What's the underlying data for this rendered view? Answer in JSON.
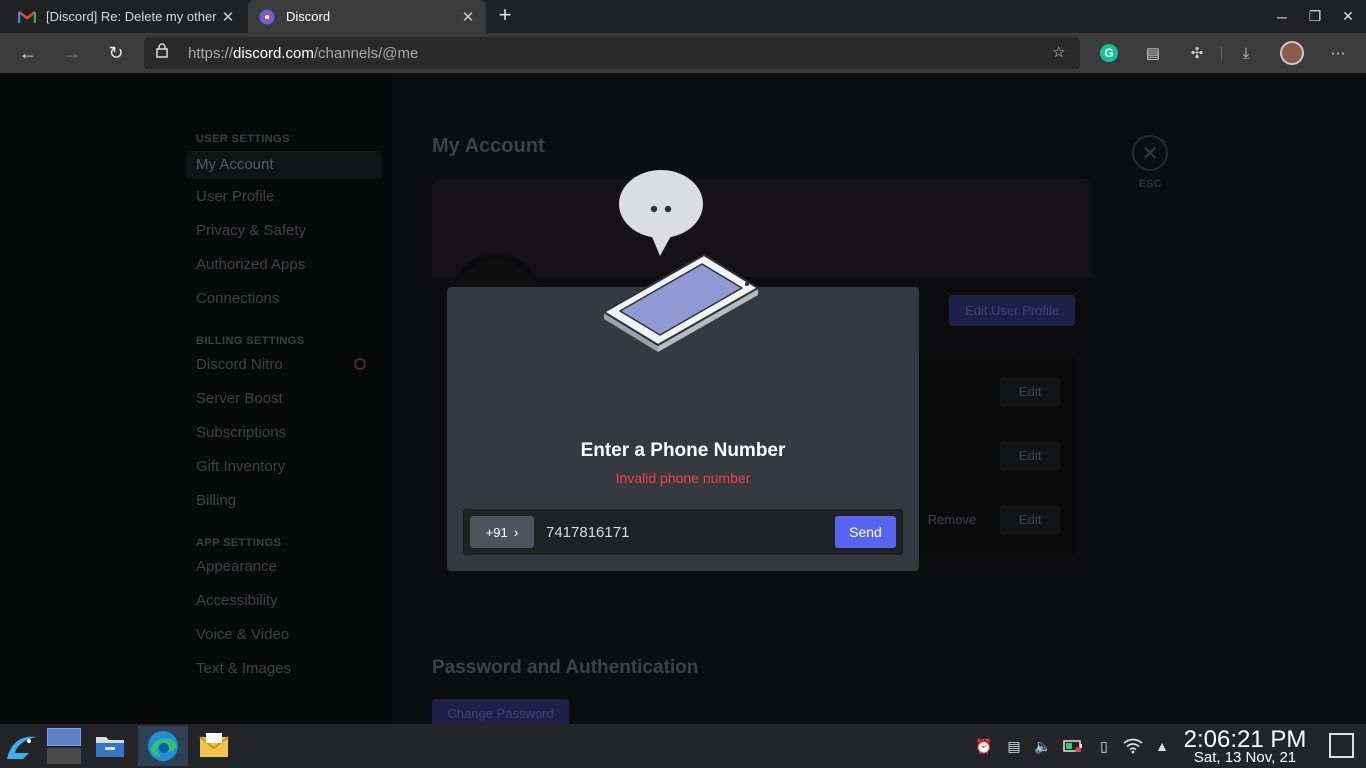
{
  "browser": {
    "tabs": [
      {
        "title": "[Discord] Re: Delete my other",
        "favicon": "gmail-icon",
        "active": false
      },
      {
        "title": "Discord",
        "favicon": "discord-icon",
        "active": true
      }
    ],
    "url_prefix": "https://",
    "url_host": "discord.com",
    "url_path": "/channels/@me",
    "new_tab_label": "+"
  },
  "settings_sidebar": {
    "user_settings_header": "USER SETTINGS",
    "user_items": [
      "My Account",
      "User Profile",
      "Privacy & Safety",
      "Authorized Apps",
      "Connections"
    ],
    "billing_header": "BILLING SETTINGS",
    "billing_items": [
      "Discord Nitro",
      "Server Boost",
      "Subscriptions",
      "Gift Inventory",
      "Billing"
    ],
    "app_header": "APP SETTINGS",
    "app_items": [
      "Appearance",
      "Accessibility",
      "Voice & Video",
      "Text & Images"
    ]
  },
  "account": {
    "title": "My Account",
    "edit_profile_label": "Edit User Profile",
    "edit_label": "Edit",
    "remove_label": "Remove",
    "password_section_title": "Password and Authentication",
    "change_password_label": "Change Password",
    "esc_label": "ESC"
  },
  "modal": {
    "title": "Enter a Phone Number",
    "error": "Invalid phone number",
    "country_code": "+91",
    "phone_value": "7417816171",
    "send_label": "Send"
  },
  "taskbar": {
    "time": "2:06:21 PM",
    "date": "Sat, 13 Nov, 21"
  },
  "colors": {
    "blurple": "#5865f2",
    "error_red": "#ed4245",
    "modal_bg": "#36393f"
  }
}
